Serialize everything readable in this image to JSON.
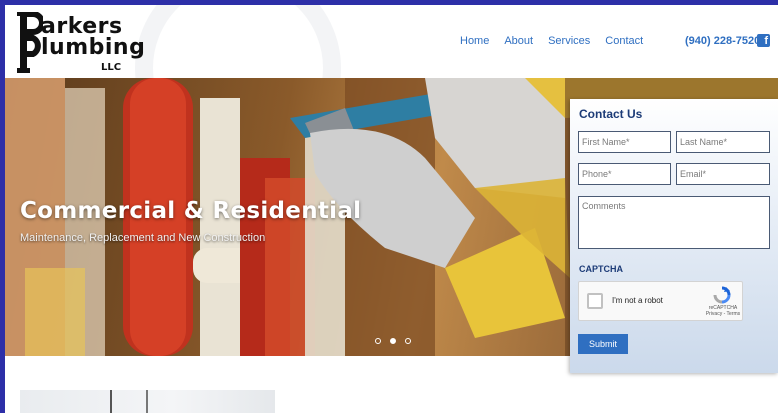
{
  "logo": {
    "line1": "arkers",
    "line2": "lumbing",
    "suffix": "LLC"
  },
  "nav": {
    "items": [
      "Home",
      "About",
      "Services",
      "Contact"
    ]
  },
  "header": {
    "phone": "(940) 228-7520",
    "social_icon": "facebook-icon"
  },
  "hero": {
    "title": "Commercial & Residential",
    "subtitle": "Maintenance, Replacement and New Construction",
    "slide_count": 3,
    "active_slide": 2
  },
  "contact": {
    "title": "Contact Us",
    "first_name_placeholder": "First Name*",
    "last_name_placeholder": "Last Name*",
    "phone_placeholder": "Phone*",
    "email_placeholder": "Email*",
    "comments_placeholder": "Comments",
    "captcha_label": "CAPTCHA",
    "recaptcha_text": "I'm not a robot",
    "recaptcha_brand": "reCAPTCHA",
    "recaptcha_links": "Privacy - Terms",
    "submit_label": "Submit"
  },
  "colors": {
    "brand_blue": "#2f6fc1",
    "heading_navy": "#1c3b77",
    "page_border": "#2d2fa8"
  }
}
